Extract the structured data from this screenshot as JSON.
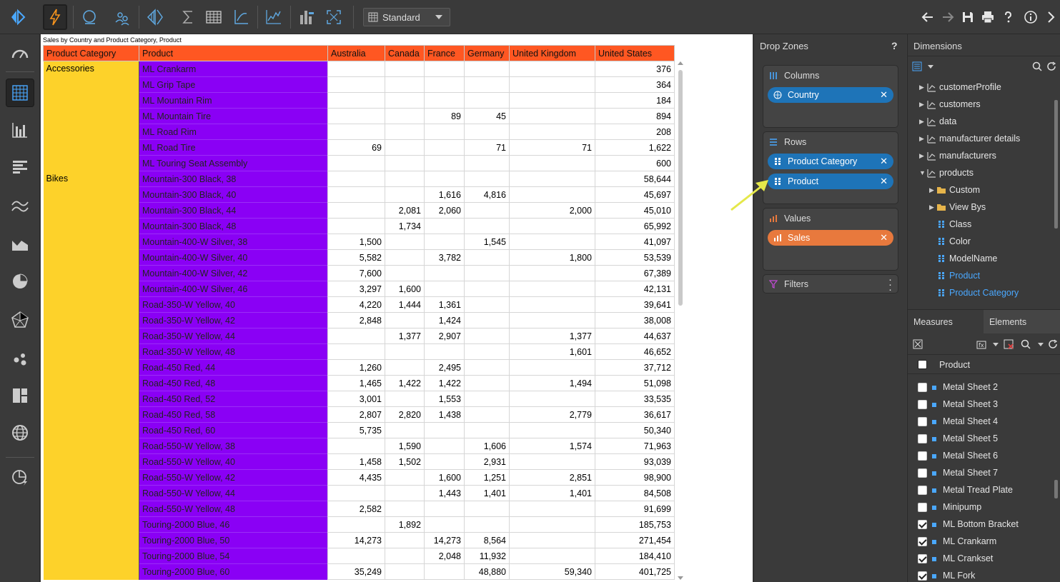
{
  "toolbar": {
    "style_select": "Standard"
  },
  "report": {
    "title": "Sales by Country and Product Category, Product",
    "headers": [
      "Product Category",
      "Product",
      "Australia",
      "Canada",
      "France",
      "Germany",
      "United Kingdom",
      "United States"
    ],
    "categories": [
      {
        "name": "Accessories",
        "rows": [
          {
            "product": "ML Crankarm",
            "values": [
              "",
              "",
              "",
              "",
              "",
              "376"
            ]
          },
          {
            "product": "ML Grip Tape",
            "values": [
              "",
              "",
              "",
              "",
              "",
              "364"
            ]
          },
          {
            "product": "ML Mountain Rim",
            "values": [
              "",
              "",
              "",
              "",
              "",
              "184"
            ]
          },
          {
            "product": "ML Mountain Tire",
            "values": [
              "",
              "",
              "89",
              "45",
              "",
              "894"
            ]
          },
          {
            "product": "ML Road Rim",
            "values": [
              "",
              "",
              "",
              "",
              "",
              "208"
            ]
          },
          {
            "product": "ML Road Tire",
            "values": [
              "69",
              "",
              "",
              "71",
              "71",
              "1,622"
            ]
          },
          {
            "product": "ML Touring Seat Assembly",
            "values": [
              "",
              "",
              "",
              "",
              "",
              "600"
            ]
          }
        ]
      },
      {
        "name": "Bikes",
        "rows": [
          {
            "product": "Mountain-300 Black, 38",
            "values": [
              "",
              "",
              "",
              "",
              "",
              "58,644"
            ]
          },
          {
            "product": "Mountain-300 Black, 40",
            "values": [
              "",
              "",
              "1,616",
              "4,816",
              "",
              "45,697"
            ]
          },
          {
            "product": "Mountain-300 Black, 44",
            "values": [
              "",
              "2,081",
              "2,060",
              "",
              "2,000",
              "45,010"
            ]
          },
          {
            "product": "Mountain-300 Black, 48",
            "values": [
              "",
              "1,734",
              "",
              "",
              "",
              "65,992"
            ]
          },
          {
            "product": "Mountain-400-W Silver, 38",
            "values": [
              "1,500",
              "",
              "",
              "1,545",
              "",
              "41,097"
            ]
          },
          {
            "product": "Mountain-400-W Silver, 40",
            "values": [
              "5,582",
              "",
              "3,782",
              "",
              "1,800",
              "53,539"
            ]
          },
          {
            "product": "Mountain-400-W Silver, 42",
            "values": [
              "7,600",
              "",
              "",
              "",
              "",
              "67,389"
            ]
          },
          {
            "product": "Mountain-400-W Silver, 46",
            "values": [
              "3,297",
              "1,600",
              "",
              "",
              "",
              "42,131"
            ]
          },
          {
            "product": "Road-350-W Yellow, 40",
            "values": [
              "4,220",
              "1,444",
              "1,361",
              "",
              "",
              "39,641"
            ]
          },
          {
            "product": "Road-350-W Yellow, 42",
            "values": [
              "2,848",
              "",
              "1,424",
              "",
              "",
              "38,008"
            ]
          },
          {
            "product": "Road-350-W Yellow, 44",
            "values": [
              "",
              "1,377",
              "2,907",
              "",
              "1,377",
              "44,637"
            ]
          },
          {
            "product": "Road-350-W Yellow, 48",
            "values": [
              "",
              "",
              "",
              "",
              "1,601",
              "46,652"
            ]
          },
          {
            "product": "Road-450 Red, 44",
            "values": [
              "1,260",
              "",
              "2,495",
              "",
              "",
              "37,712"
            ]
          },
          {
            "product": "Road-450 Red, 48",
            "values": [
              "1,465",
              "1,422",
              "1,422",
              "",
              "1,494",
              "51,098"
            ]
          },
          {
            "product": "Road-450 Red, 52",
            "values": [
              "3,001",
              "",
              "1,553",
              "",
              "",
              "33,535"
            ]
          },
          {
            "product": "Road-450 Red, 58",
            "values": [
              "2,807",
              "2,820",
              "1,438",
              "",
              "2,779",
              "36,617"
            ]
          },
          {
            "product": "Road-450 Red, 60",
            "values": [
              "5,735",
              "",
              "",
              "",
              "",
              "50,340"
            ]
          },
          {
            "product": "Road-550-W Yellow, 38",
            "values": [
              "",
              "1,590",
              "",
              "1,606",
              "1,574",
              "71,963"
            ]
          },
          {
            "product": "Road-550-W Yellow, 40",
            "values": [
              "1,458",
              "1,502",
              "",
              "2,931",
              "",
              "93,039"
            ]
          },
          {
            "product": "Road-550-W Yellow, 42",
            "values": [
              "4,435",
              "",
              "1,600",
              "1,251",
              "2,851",
              "98,900"
            ]
          },
          {
            "product": "Road-550-W Yellow, 44",
            "values": [
              "",
              "",
              "1,443",
              "1,401",
              "1,401",
              "84,508"
            ]
          },
          {
            "product": "Road-550-W Yellow, 48",
            "values": [
              "2,582",
              "",
              "",
              "",
              "",
              "91,699"
            ]
          },
          {
            "product": "Touring-2000 Blue, 46",
            "values": [
              "",
              "1,892",
              "",
              "",
              "",
              "185,753"
            ]
          },
          {
            "product": "Touring-2000 Blue, 50",
            "values": [
              "14,273",
              "",
              "14,273",
              "8,564",
              "",
              "271,454"
            ]
          },
          {
            "product": "Touring-2000 Blue, 54",
            "values": [
              "",
              "",
              "2,048",
              "11,932",
              "",
              "184,410"
            ]
          },
          {
            "product": "Touring-2000 Blue, 60",
            "values": [
              "35,249",
              "",
              "",
              "48,880",
              "59,340",
              "401,725"
            ]
          }
        ]
      }
    ],
    "colors": {
      "header": "#ff5722",
      "category": "#fdd22a",
      "product": "#8a00f5"
    }
  },
  "dropzones": {
    "title": "Drop Zones",
    "help": "?",
    "columns_label": "Columns",
    "rows_label": "Rows",
    "values_label": "Values",
    "filters_label": "Filters",
    "columns": [
      "Country"
    ],
    "rows": [
      "Product Category",
      "Product"
    ],
    "values": [
      "Sales"
    ]
  },
  "dimensions": {
    "title": "Dimensions",
    "tree": [
      {
        "label": "customerProfile",
        "kind": "table",
        "level": 0,
        "expanded": false
      },
      {
        "label": "customers",
        "kind": "table",
        "level": 0,
        "expanded": false
      },
      {
        "label": "data",
        "kind": "table",
        "level": 0,
        "expanded": false
      },
      {
        "label": "manufacturer details",
        "kind": "table",
        "level": 0,
        "expanded": false
      },
      {
        "label": "manufacturers",
        "kind": "table",
        "level": 0,
        "expanded": false
      },
      {
        "label": "products",
        "kind": "table",
        "level": 0,
        "expanded": true
      },
      {
        "label": "Custom",
        "kind": "folder",
        "level": 1,
        "expanded": false
      },
      {
        "label": "View Bys",
        "kind": "folder",
        "level": 1,
        "expanded": false
      },
      {
        "label": "Class",
        "kind": "hierarchy",
        "level": 1
      },
      {
        "label": "Color",
        "kind": "hierarchy",
        "level": 1
      },
      {
        "label": "ModelName",
        "kind": "hierarchy",
        "level": 1
      },
      {
        "label": "Product",
        "kind": "hierarchy",
        "level": 1,
        "highlight": true
      },
      {
        "label": "Product Category",
        "kind": "hierarchy",
        "level": 1,
        "highlight": true
      }
    ]
  },
  "elements_panel": {
    "tabs": [
      "Measures",
      "Elements"
    ],
    "hierarchy": "Product",
    "items": [
      {
        "label": "Metal Sheet 2",
        "checked": false
      },
      {
        "label": "Metal Sheet 3",
        "checked": false
      },
      {
        "label": "Metal Sheet 4",
        "checked": false
      },
      {
        "label": "Metal Sheet 5",
        "checked": false
      },
      {
        "label": "Metal Sheet 6",
        "checked": false
      },
      {
        "label": "Metal Sheet 7",
        "checked": false
      },
      {
        "label": "Metal Tread Plate",
        "checked": false
      },
      {
        "label": "Minipump",
        "checked": false
      },
      {
        "label": "ML Bottom Bracket",
        "checked": true
      },
      {
        "label": "ML Crankarm",
        "checked": true
      },
      {
        "label": "ML Crankset",
        "checked": true
      },
      {
        "label": "ML Fork",
        "checked": true
      }
    ]
  }
}
